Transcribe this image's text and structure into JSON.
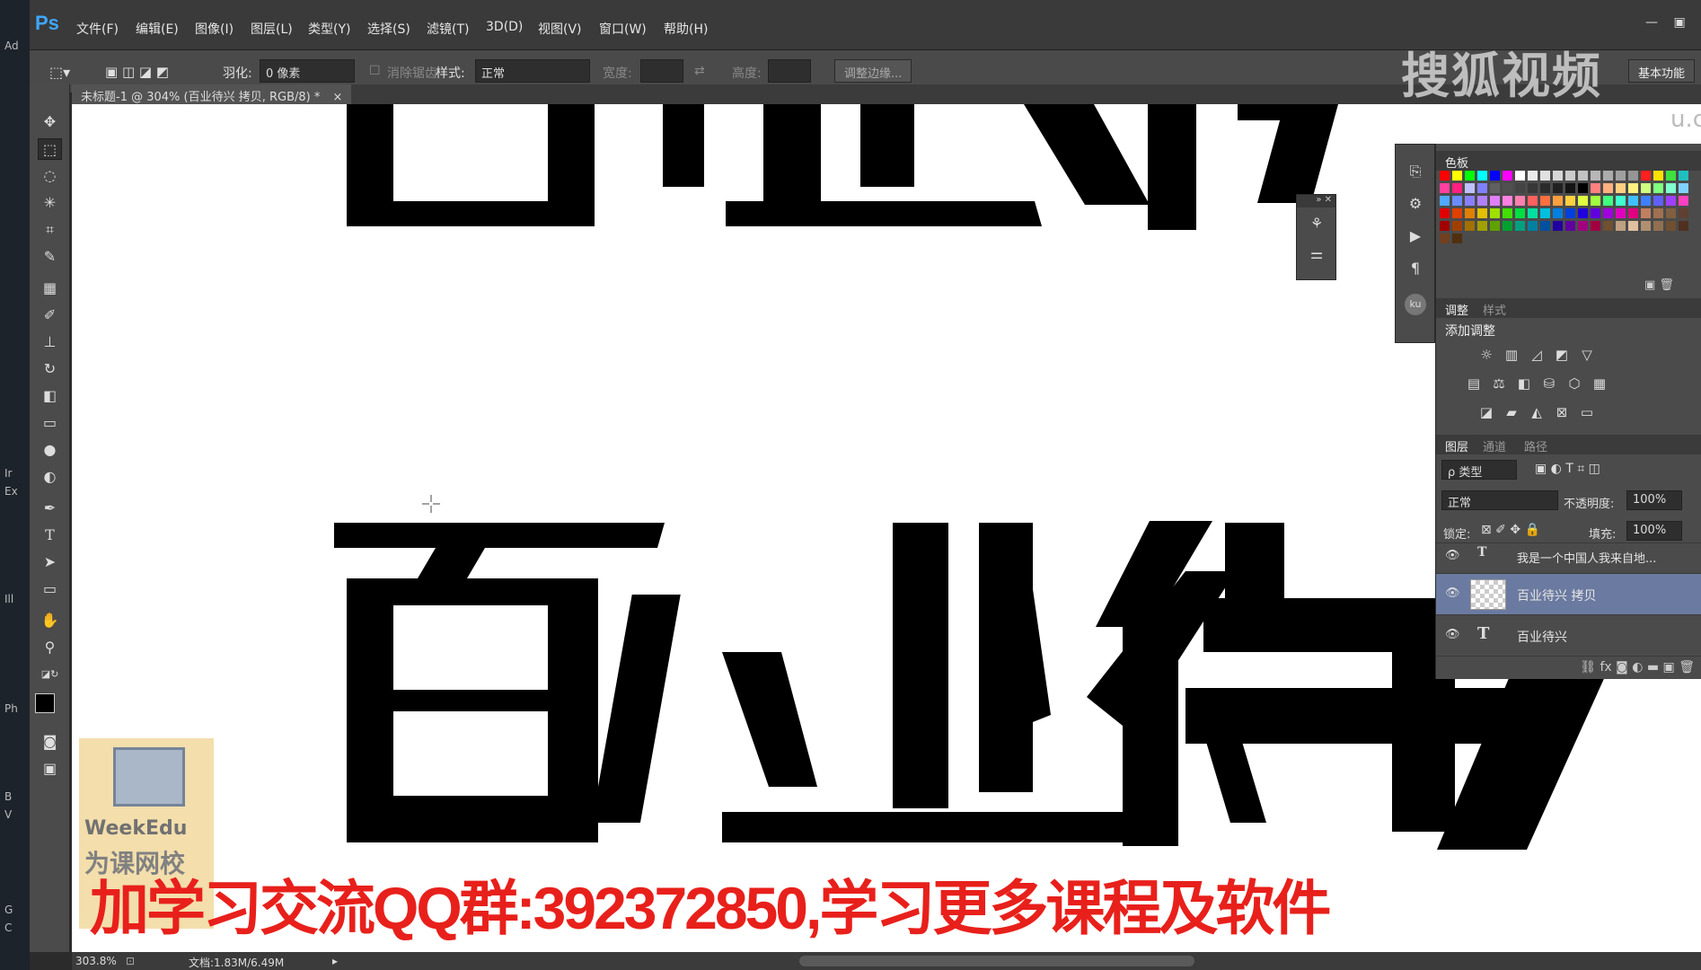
{
  "app": {
    "logo": "Ps",
    "menus": [
      "文件(F)",
      "编辑(E)",
      "图像(I)",
      "图层(L)",
      "类型(Y)",
      "选择(S)",
      "滤镜(T)",
      "3D(D)",
      "视图(V)",
      "窗口(W)",
      "帮助(H)"
    ],
    "window_controls": [
      "—",
      "▣"
    ]
  },
  "desktop": {
    "labels": [
      "Ad",
      "Ir",
      "Ex",
      "Ill",
      "Ph",
      "B",
      "V",
      "G",
      "C"
    ]
  },
  "options": {
    "feather_label": "羽化:",
    "feather_value": "0 像素",
    "antialias_label": "消除锯齿",
    "style_label": "样式:",
    "style_value": "正常",
    "width_label": "宽度:",
    "height_label": "高度:",
    "refine_button": "调整边缘...",
    "workspace": "基本功能"
  },
  "document": {
    "tab_title": "未标题-1 @ 304% (百业待兴 拷贝, RGB/8) *",
    "close": "×"
  },
  "canvas": {
    "top_text": "百业待",
    "bottom_text": "百业待",
    "color_primary": "#000000",
    "color_bg": "#ffffff"
  },
  "status": {
    "zoom": "303.8%",
    "doc": "文档:1.83M/6.49M"
  },
  "watermark": {
    "sohu": "搜狐视频",
    "sohu_small": "u.c"
  },
  "swatches_panel": {
    "tab": "色板"
  },
  "adjust_panel": {
    "tabs": [
      "调整",
      "样式"
    ],
    "title": "添加调整"
  },
  "layers_panel": {
    "tabs": [
      "图层",
      "通道",
      "路径"
    ],
    "filter": "ρ 类型",
    "blend": "正常",
    "opacity_label": "不透明度:",
    "opacity": "100%",
    "lock_label": "锁定:",
    "fill_label": "填充:",
    "fill": "100%",
    "layers": [
      {
        "name": "我是一个中国人我来自地...",
        "type": "text",
        "selected": false
      },
      {
        "name": "百业待兴 拷贝",
        "type": "raster",
        "selected": true
      },
      {
        "name": "百业待兴",
        "type": "text",
        "selected": false
      }
    ]
  },
  "weekedu": {
    "brand": "WeekEdu",
    "cn": "为课网校"
  },
  "banner": {
    "text": "加学习交流QQ群:392372850,学习更多课程及软件"
  }
}
